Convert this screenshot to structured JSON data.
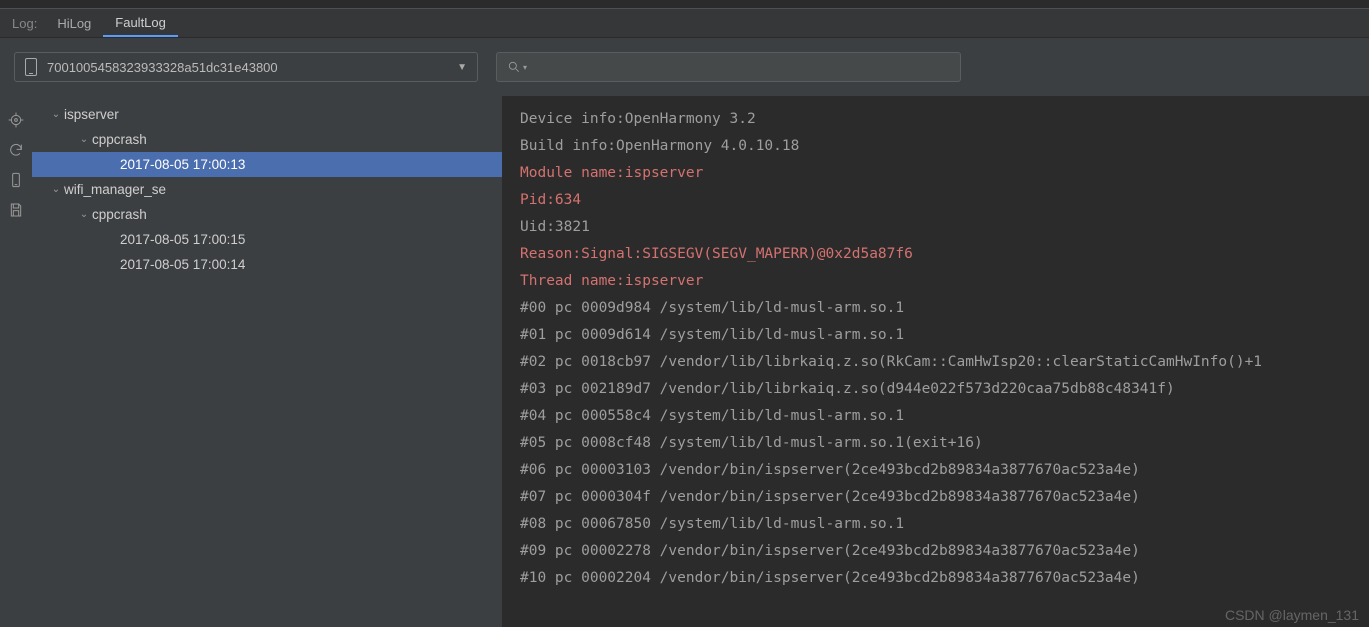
{
  "tabs": {
    "label": "Log:",
    "items": [
      "HiLog",
      "FaultLog"
    ],
    "active": 1
  },
  "device": {
    "id": "7001005458323933328a51dc31e43800"
  },
  "search": {
    "placeholder": ""
  },
  "tree": [
    {
      "depth": 0,
      "expander": true,
      "label": "ispserver",
      "selected": false
    },
    {
      "depth": 1,
      "expander": true,
      "label": "cppcrash",
      "selected": false
    },
    {
      "depth": 2,
      "expander": false,
      "label": "2017-08-05 17:00:13",
      "selected": true
    },
    {
      "depth": 0,
      "expander": true,
      "label": "wifi_manager_se",
      "selected": false
    },
    {
      "depth": 1,
      "expander": true,
      "label": "cppcrash",
      "selected": false
    },
    {
      "depth": 2,
      "expander": false,
      "label": "2017-08-05 17:00:15",
      "selected": false
    },
    {
      "depth": 2,
      "expander": false,
      "label": "2017-08-05 17:00:14",
      "selected": false
    }
  ],
  "log": [
    {
      "c": "plain",
      "t": "Device info:OpenHarmony 3.2"
    },
    {
      "c": "plain",
      "t": "Build info:OpenHarmony 4.0.10.18"
    },
    {
      "c": "red",
      "t": "Module name:ispserver"
    },
    {
      "c": "red",
      "t": "Pid:634"
    },
    {
      "c": "plain",
      "t": "Uid:3821"
    },
    {
      "c": "red",
      "t": "Reason:Signal:SIGSEGV(SEGV_MAPERR)@0x2d5a87f6"
    },
    {
      "c": "red",
      "t": "Thread name:ispserver"
    },
    {
      "c": "plain",
      "t": "#00 pc 0009d984 /system/lib/ld-musl-arm.so.1"
    },
    {
      "c": "plain",
      "t": "#01 pc 0009d614 /system/lib/ld-musl-arm.so.1"
    },
    {
      "c": "plain",
      "t": "#02 pc 0018cb97 /vendor/lib/librkaiq.z.so(RkCam::CamHwIsp20::clearStaticCamHwInfo()+1"
    },
    {
      "c": "plain",
      "t": "#03 pc 002189d7 /vendor/lib/librkaiq.z.so(d944e022f573d220caa75db88c48341f)"
    },
    {
      "c": "plain",
      "t": "#04 pc 000558c4 /system/lib/ld-musl-arm.so.1"
    },
    {
      "c": "plain",
      "t": "#05 pc 0008cf48 /system/lib/ld-musl-arm.so.1(exit+16)"
    },
    {
      "c": "plain",
      "t": "#06 pc 00003103 /vendor/bin/ispserver(2ce493bcd2b89834a3877670ac523a4e)"
    },
    {
      "c": "plain",
      "t": "#07 pc 0000304f /vendor/bin/ispserver(2ce493bcd2b89834a3877670ac523a4e)"
    },
    {
      "c": "plain",
      "t": "#08 pc 00067850 /system/lib/ld-musl-arm.so.1"
    },
    {
      "c": "plain",
      "t": "#09 pc 00002278 /vendor/bin/ispserver(2ce493bcd2b89834a3877670ac523a4e)"
    },
    {
      "c": "plain",
      "t": "#10 pc 00002204 /vendor/bin/ispserver(2ce493bcd2b89834a3877670ac523a4e)"
    }
  ],
  "watermark": "CSDN @laymen_131"
}
